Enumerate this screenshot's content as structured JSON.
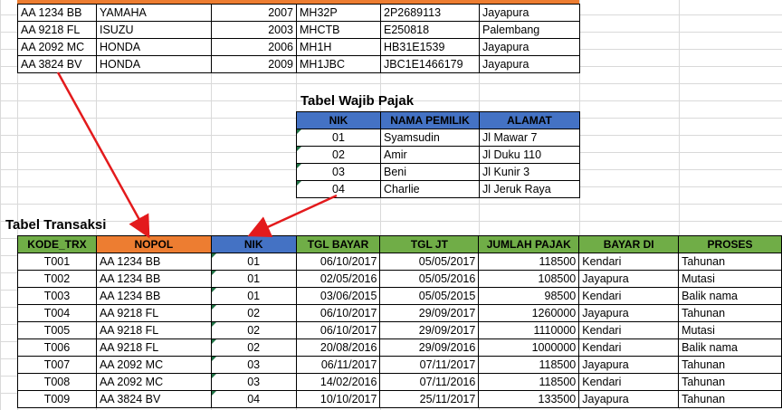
{
  "vehicles": [
    {
      "nopol": "AA 1234 BB",
      "merk": "YAMAHA",
      "tahun": "2007",
      "rangka": "MH32P",
      "mesin": "2P2689113",
      "kota": "Jayapura"
    },
    {
      "nopol": "AA 9218 FL",
      "merk": "ISUZU",
      "tahun": "2003",
      "rangka": "MHCTB",
      "mesin": "E250818",
      "kota": "Palembang"
    },
    {
      "nopol": "AA 2092 MC",
      "merk": "HONDA",
      "tahun": "2006",
      "rangka": "MH1H",
      "mesin": "HB31E1539",
      "kota": "Jayapura"
    },
    {
      "nopol": "AA 3824 BV",
      "merk": "HONDA",
      "tahun": "2009",
      "rangka": "MH1JBC",
      "mesin": "JBC1E1466179",
      "kota": "Jayapura"
    }
  ],
  "wajib_pajak": {
    "title": "Tabel Wajib Pajak",
    "headers": [
      "NIK",
      "NAMA PEMILIK",
      "ALAMAT"
    ],
    "rows": [
      [
        "01",
        "Syamsudin",
        "Jl Mawar 7"
      ],
      [
        "02",
        "Amir",
        "Jl Duku 110"
      ],
      [
        "03",
        "Beni",
        "Jl Kunir 3"
      ],
      [
        "04",
        "Charlie",
        "Jl Jeruk Raya"
      ]
    ]
  },
  "transaksi": {
    "title": "Tabel Transaksi",
    "headers": [
      "KODE_TRX",
      "NOPOL",
      "NIK",
      "TGL BAYAR",
      "TGL JT",
      "JUMLAH PAJAK",
      "BAYAR DI",
      "PROSES"
    ],
    "rows": [
      [
        "T001",
        "AA 1234 BB",
        "01",
        "06/10/2017",
        "05/05/2017",
        "118500",
        "Kendari",
        "Tahunan"
      ],
      [
        "T002",
        "AA 1234 BB",
        "01",
        "02/05/2016",
        "05/05/2016",
        "108500",
        "Jayapura",
        "Mutasi"
      ],
      [
        "T003",
        "AA 1234 BB",
        "01",
        "03/06/2015",
        "05/05/2015",
        "98500",
        "Kendari",
        "Balik nama"
      ],
      [
        "T004",
        "AA 9218 FL",
        "02",
        "06/10/2017",
        "29/09/2017",
        "1260000",
        "Jayapura",
        "Tahunan"
      ],
      [
        "T005",
        "AA 9218 FL",
        "02",
        "06/10/2017",
        "29/09/2017",
        "1110000",
        "Kendari",
        "Mutasi"
      ],
      [
        "T006",
        "AA 9218 FL",
        "02",
        "20/08/2016",
        "29/09/2016",
        "1000000",
        "Kendari",
        "Balik nama"
      ],
      [
        "T007",
        "AA 2092 MC",
        "03",
        "06/11/2017",
        "07/11/2017",
        "118500",
        "Jayapura",
        "Tahunan"
      ],
      [
        "T008",
        "AA 2092 MC",
        "03",
        "14/02/2016",
        "07/11/2016",
        "118500",
        "Kendari",
        "Tahunan"
      ],
      [
        "T009",
        "AA 3824 BV",
        "04",
        "10/10/2017",
        "25/11/2017",
        "133500",
        "Jayapura",
        "Tahunan"
      ]
    ]
  },
  "colors": {
    "header_green": "#70ad47",
    "header_orange": "#ed7d31",
    "header_blue": "#4472c4",
    "arrow": "#e31a1c"
  }
}
